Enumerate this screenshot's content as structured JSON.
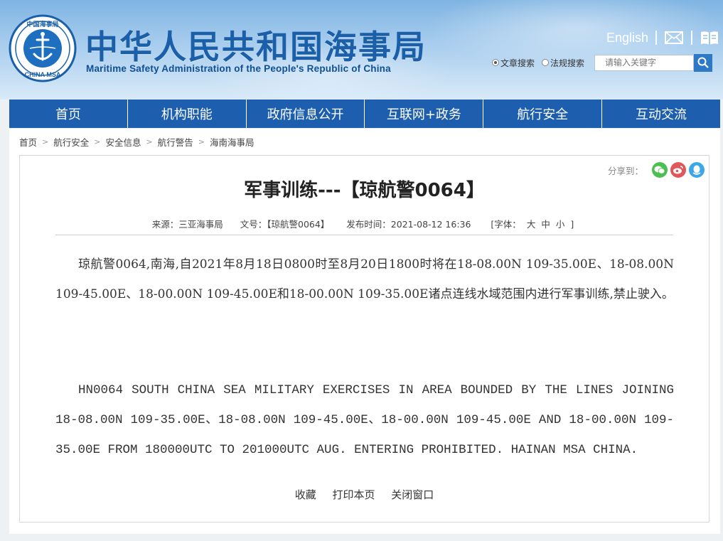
{
  "header": {
    "title": "中华人民共和国海事局",
    "subtitle": "Maritime Safety Administration of the People's Republic of China",
    "logo_text_top": "中国海事局",
    "logo_text_bottom": "CHINA MSA",
    "english_link": "English",
    "search": {
      "option_article": "文章搜索",
      "option_law": "法规搜索",
      "placeholder": "请输入关键字"
    }
  },
  "nav": {
    "items": [
      "首页",
      "机构职能",
      "政府信息公开",
      "互联网+政务",
      "航行安全",
      "互动交流"
    ]
  },
  "breadcrumb": [
    "首页",
    "航行安全",
    "安全信息",
    "航行警告",
    "海南海事局"
  ],
  "article": {
    "share_label": "分享到：",
    "title": "军事训练---【琼航警0064】",
    "meta": {
      "source": "来源：三亚海事局",
      "doc_no": "文号：【琼航警0064】",
      "published": "发布时间：2021-08-12 16:36",
      "font_label": "[字体：",
      "font_large": "大",
      "font_medium": "中",
      "font_small": "小",
      "font_close": "]"
    },
    "body_cn": "琼航警0064,南海,自2021年8月18日0800时至8月20日1800时将在18-08.00N 109-35.00E、18-08.00N 109-45.00E、18-00.00N 109-45.00E和18-00.00N 109-35.00E诸点连线水域范围内进行军事训练,禁止驶入。",
    "body_en": "HN0064 SOUTH CHINA SEA MILITARY EXERCISES IN AREA BOUNDED BY THE LINES JOINING 18-08.00N 109-35.00E、18-08.00N 109-45.00E、18-00.00N 109-45.00E AND 18-00.00N 109-35.00E FROM 180000UTC TO 201000UTC AUG. ENTERING PROHIBITED. HAINAN MSA CHINA.",
    "actions": {
      "favorite": "收藏",
      "print": "打印本页",
      "close": "关闭窗口"
    }
  },
  "colors": {
    "nav_bg": "#1d5fae",
    "title_blue": "#1a5fa8",
    "search_btn": "#2e79c6",
    "wechat": "#4cbf52",
    "weibo": "#e0575a",
    "qq": "#3ba6e8"
  }
}
